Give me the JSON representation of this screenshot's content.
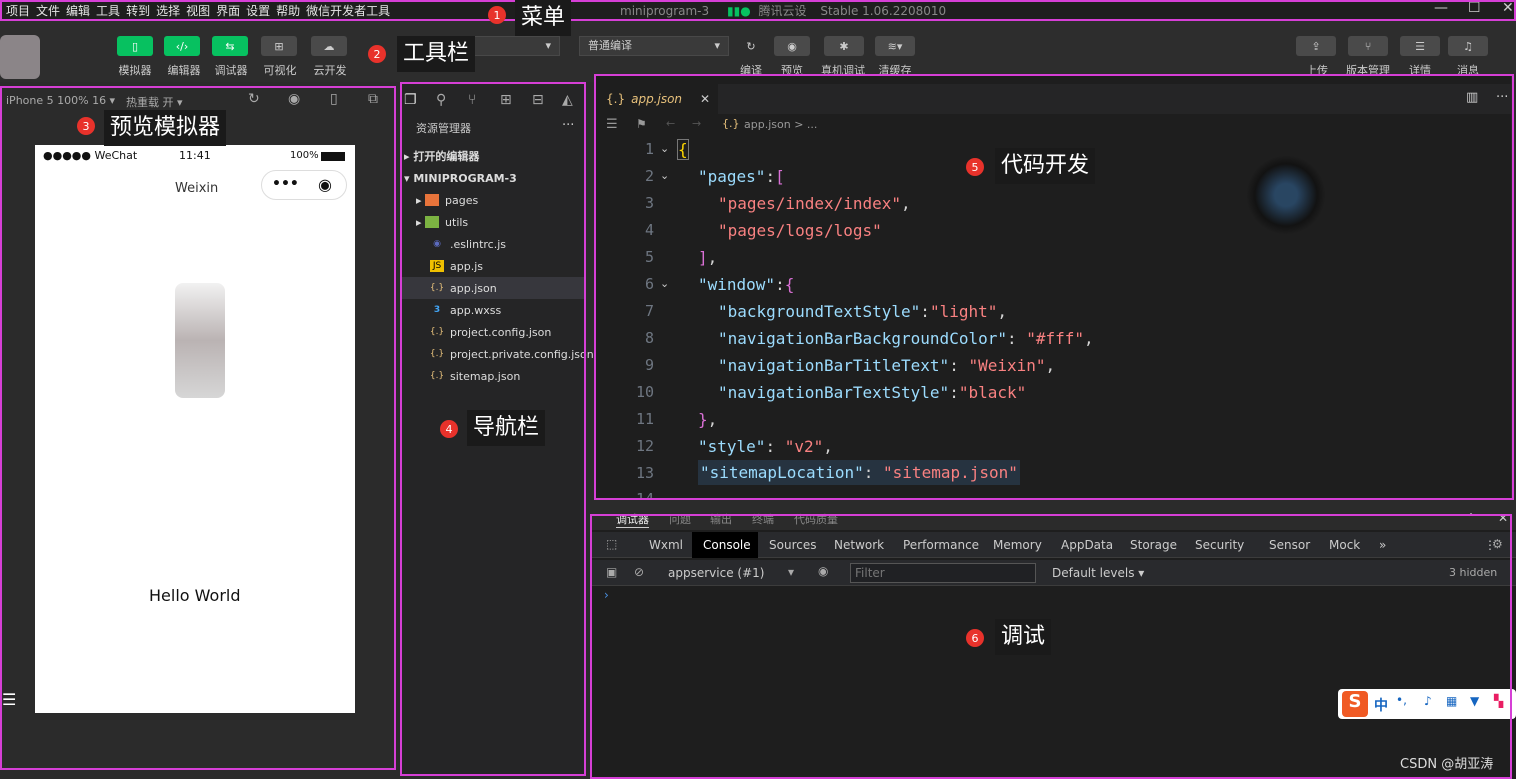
{
  "menu": {
    "items": [
      "项目",
      "文件",
      "编辑",
      "工具",
      "转到",
      "选择",
      "视图",
      "界面",
      "设置",
      "帮助",
      "微信开发者工具"
    ],
    "title": "miniprogram-3",
    "cloud": "腾讯云设",
    "version": "Stable 1.06.2208010"
  },
  "toolbar": {
    "left_buttons": [
      {
        "icon": "phone-icon",
        "label": "模拟器"
      },
      {
        "icon": "code-icon",
        "label": "编辑器"
      },
      {
        "icon": "debug-icon",
        "label": "调试器"
      },
      {
        "icon": "layout-icon",
        "label": "可视化"
      },
      {
        "icon": "cloud-icon",
        "label": "云开发"
      }
    ],
    "compile_select": "普通编译",
    "mid_buttons": [
      "编译",
      "预览",
      "真机调试",
      "清缓存"
    ],
    "right_buttons": [
      "上传",
      "版本管理",
      "详情",
      "消息"
    ]
  },
  "simulator": {
    "device": "iPhone 5 100% 16 ▾",
    "hot_reload": "热重载 开 ▾",
    "status_carrier": "●●●●● WeChat",
    "status_time": "11:41",
    "status_battery": "100%",
    "nav_title": "Weixin",
    "hello": "Hello World"
  },
  "explorer": {
    "title": "资源管理器",
    "open_editors": "打开的编辑器",
    "project": "MINIPROGRAM-3",
    "files": [
      {
        "name": "pages",
        "type": "folder-orange",
        "indent": 1
      },
      {
        "name": "utils",
        "type": "folder-green",
        "indent": 1
      },
      {
        "name": ".eslintrc.js",
        "type": "eslint",
        "indent": 1
      },
      {
        "name": "app.js",
        "type": "js",
        "indent": 1
      },
      {
        "name": "app.json",
        "type": "json",
        "indent": 1,
        "selected": true
      },
      {
        "name": "app.wxss",
        "type": "css",
        "indent": 1
      },
      {
        "name": "project.config.json",
        "type": "json",
        "indent": 1
      },
      {
        "name": "project.private.config.json",
        "type": "json",
        "indent": 1
      },
      {
        "name": "sitemap.json",
        "type": "json",
        "indent": 1
      }
    ]
  },
  "editor": {
    "tab": "app.json",
    "breadcrumb": "app.json > ...",
    "lines": [
      "1",
      "2",
      "3",
      "4",
      "5",
      "6",
      "7",
      "8",
      "9",
      "10",
      "11",
      "12",
      "13",
      "14"
    ]
  },
  "debugger": {
    "panel_tabs": [
      "调试器",
      "问题",
      "输出",
      "终端",
      "代码质量"
    ],
    "dev_tabs": [
      "Wxml",
      "Console",
      "Sources",
      "Network",
      "Performance",
      "Memory",
      "AppData",
      "Storage",
      "Security",
      "Sensor",
      "Mock"
    ],
    "active_tab": "Console",
    "context": "appservice (#1)",
    "filter_placeholder": "Filter",
    "levels": "Default levels ▾",
    "hidden": "3 hidden"
  },
  "callouts": [
    {
      "num": "1",
      "label": "菜单"
    },
    {
      "num": "2",
      "label": "工具栏"
    },
    {
      "num": "3",
      "label": "预览模拟器"
    },
    {
      "num": "4",
      "label": "导航栏"
    },
    {
      "num": "5",
      "label": "代码开发"
    },
    {
      "num": "6",
      "label": "调试"
    }
  ],
  "ime": {
    "label": "中"
  },
  "watermark": "CSDN @胡亚涛",
  "colors": {
    "accent_green": "#07c160",
    "callout_border": "#d63fd6",
    "callout_dot": "#e8322b"
  }
}
